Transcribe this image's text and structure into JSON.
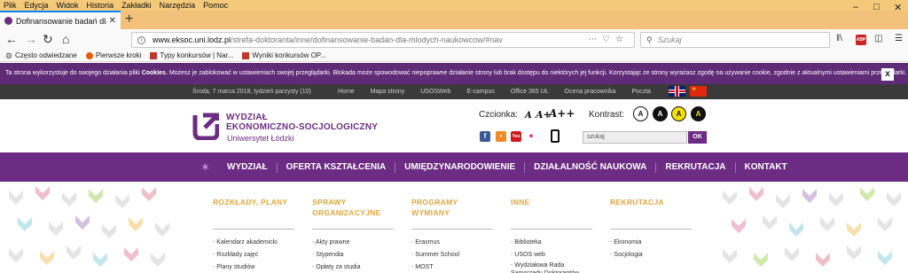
{
  "browser": {
    "menu": [
      "Plik",
      "Edycja",
      "Widok",
      "Historia",
      "Zakładki",
      "Narzędzia",
      "Pomoc"
    ],
    "tab_title": "Dofinansowanie badań dla mło",
    "url_domain": "www.eksoc.uni.lodz.pl",
    "url_path": "/strefa-doktoranta/inne/dofinansowanie-badan-dla-mlodych-naukowcow/#nav",
    "search_placeholder": "Szukaj",
    "bookmarks": [
      "Często odwiedzane",
      "Pierwsze kroki",
      "Typy konkursów | Nar...",
      "Wyniki konkursów OP..."
    ]
  },
  "cookie": {
    "text": "Ta strona wykorzystuje do swojego działania pliki Cookies. Możesz je zablokować w ustawieniach swojej przeglądarki. Blokada może spowodować niepoprawne działanie strony lub brak dostępu do niektórych jej funkcji. Korzystając ze strony wyrażasz zgodę na używanie cookie, zgodnie z aktualnymi ustawieniami przeglądarki.",
    "close": "x"
  },
  "topbar": {
    "date": "Środa, 7 marca 2018, tydzień parzysty (10)",
    "links": [
      "Home",
      "Mapa strony",
      "USOSWeb",
      "E-campus",
      "Office 365 UŁ",
      "Ocena pracownika",
      "Poczta"
    ]
  },
  "header": {
    "logo_line1": "WYDZIAŁ",
    "logo_line2": "EKONOMICZNO-SOCJOLOGICZNY",
    "logo_line3": "Uniwersytet Łódzki",
    "font_label": "Czcionka:",
    "font_sizes": [
      "A",
      "A+",
      "A++"
    ],
    "contrast_label": "Kontrast:",
    "contrast_options": [
      "A",
      "A",
      "A",
      "A"
    ],
    "search_value": "szukaj",
    "search_button": "OK"
  },
  "nav": [
    "WYDZIAŁ",
    "OFERTA KSZTAŁCENIA",
    "UMIĘDZYNARODOWIENIE",
    "DZIAŁALNOŚĆ NAUKOWA",
    "REKRUTACJA",
    "KONTAKT"
  ],
  "columns": [
    {
      "title": "ROZKŁADY, PLANY",
      "items": [
        "Kalendarz akademicki",
        "Rozkłady zajęć",
        "Plany studiów"
      ]
    },
    {
      "title": "SPRAWY ORGANIZACYJNE",
      "items": [
        "Akty prawne",
        "Stypendia",
        "Opłaty za studia"
      ]
    },
    {
      "title": "PROGRAMY WYMIANY",
      "items": [
        "Erasmus",
        "Summer School",
        "MOST"
      ]
    },
    {
      "title": "INNE",
      "items": [
        "Biblioteka",
        "USOS web",
        "Wydziałowa Rada Samorządu Doktorantów"
      ]
    },
    {
      "title": "REKRUTACJA",
      "items": [
        "Ekonomia",
        "Socjologia"
      ]
    }
  ],
  "colors": {
    "purple": "#6c2c83",
    "cookie": "#5f2a76",
    "orange": "#e3a63a",
    "dark": "#3a3a3a"
  }
}
